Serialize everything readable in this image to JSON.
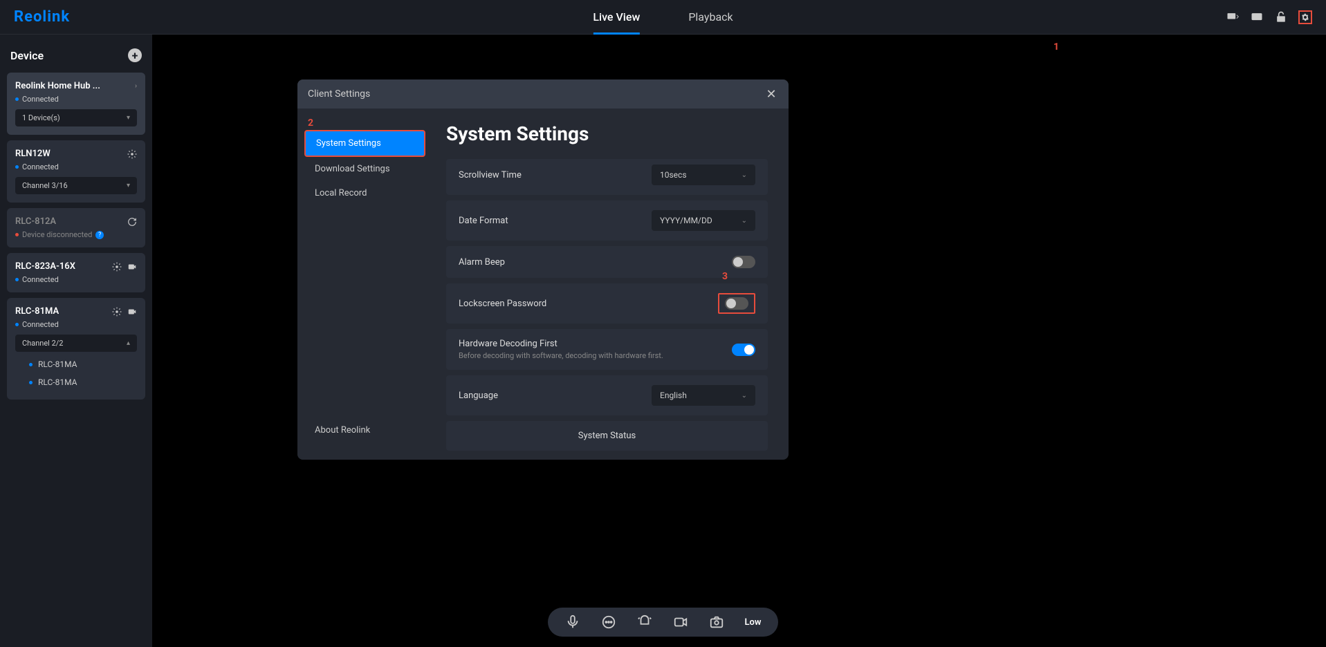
{
  "header": {
    "logo": "Reolink",
    "tabs": {
      "live": "Live View",
      "playback": "Playback"
    }
  },
  "sidebar": {
    "title": "Device",
    "devices": [
      {
        "name": "Reolink Home Hub ...",
        "status": "Connected",
        "channel": "1 Device(s)"
      },
      {
        "name": "RLN12W",
        "status": "Connected",
        "channel": "Channel 3/16"
      },
      {
        "name": "RLC-812A",
        "status": "Device disconnected"
      },
      {
        "name": "RLC-823A-16X",
        "status": "Connected"
      },
      {
        "name": "RLC-81MA",
        "status": "Connected",
        "channel": "Channel 2/2",
        "sub": [
          "RLC-81MA",
          "RLC-81MA"
        ]
      }
    ]
  },
  "modal": {
    "title": "Client Settings",
    "nav": {
      "system": "System Settings",
      "download": "Download Settings",
      "local": "Local Record"
    },
    "about": "About Reolink",
    "content": {
      "heading": "System Settings",
      "scrollview_label": "Scrollview Time",
      "scrollview_value": "10secs",
      "date_label": "Date Format",
      "date_value": "YYYY/MM/DD",
      "alarm_label": "Alarm Beep",
      "lock_label": "Lockscreen Password",
      "hardware_label": "Hardware Decoding First",
      "hardware_sub": "Before decoding with software, decoding with hardware first.",
      "lang_label": "Language",
      "lang_value": "English",
      "status_btn": "System Status"
    }
  },
  "toolbar": {
    "quality": "Low"
  },
  "annot": {
    "a1": "1",
    "a2": "2",
    "a3": "3"
  }
}
